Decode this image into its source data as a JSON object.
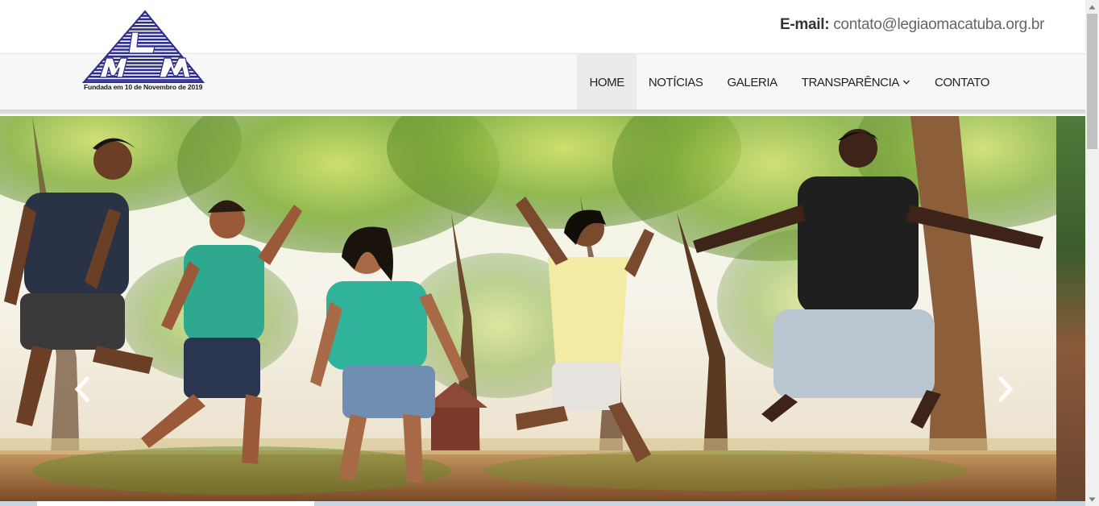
{
  "header": {
    "email_label": "E-mail:",
    "email_value": "contato@legiaomacatuba.org.br"
  },
  "logo": {
    "letters": [
      "L",
      "M",
      "M"
    ],
    "caption": "Fundada em 10 de Novembro de 2019",
    "color": "#2c2c8c"
  },
  "nav": {
    "items": [
      {
        "label": "HOME",
        "active": true
      },
      {
        "label": "NOTÍCIAS",
        "active": false
      },
      {
        "label": "GALERIA",
        "active": false
      },
      {
        "label": "TRANSPARÊNCIA",
        "active": false,
        "dropdown": true
      },
      {
        "label": "CONTATO",
        "active": false
      }
    ]
  },
  "slider": {
    "image_description": "Five young people jumping in the air outdoors under trees",
    "prev_icon": "chevron-left-icon",
    "next_icon": "chevron-right-icon"
  },
  "colors": {
    "navbar_bg": "#f7f7f7",
    "active_bg": "#ebebeb",
    "text": "#222222"
  }
}
